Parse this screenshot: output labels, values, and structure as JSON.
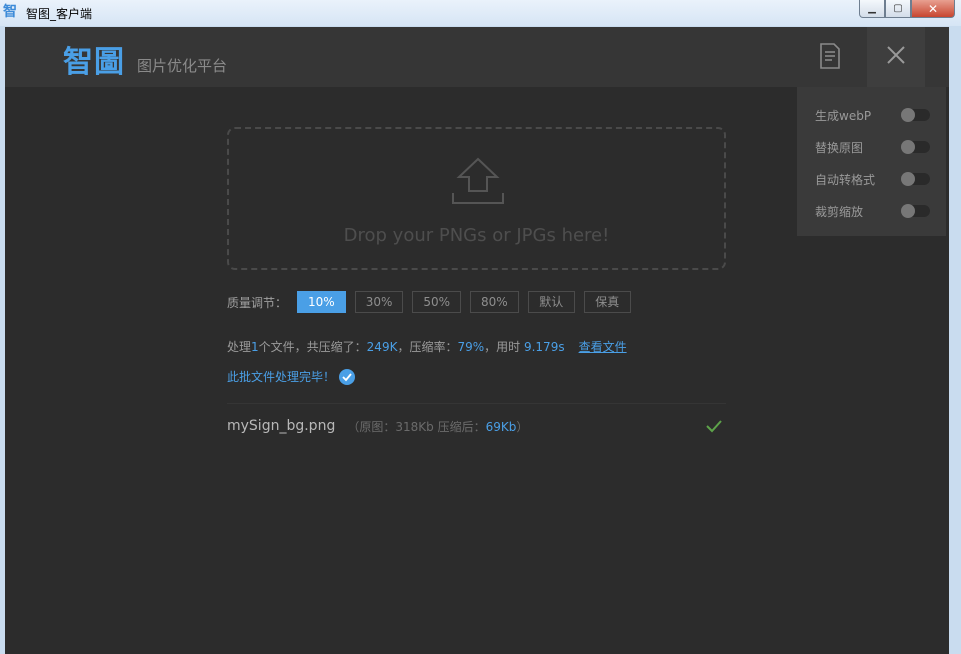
{
  "window": {
    "icon_char": "智",
    "title": "智图_客户端",
    "min_label": "▁",
    "max_label": "▢",
    "close_label": "✕"
  },
  "header": {
    "logo": "智圖",
    "subtitle": "图片优化平台"
  },
  "settings": [
    {
      "label": "生成webP",
      "on": false
    },
    {
      "label": "替换原图",
      "on": false
    },
    {
      "label": "自动转格式",
      "on": false
    },
    {
      "label": "裁剪缩放",
      "on": false
    }
  ],
  "dropzone": {
    "text": "Drop your PNGs or JPGs here!"
  },
  "quality": {
    "label": "质量调节：",
    "options": [
      "10%",
      "30%",
      "50%",
      "80%",
      "默认",
      "保真"
    ],
    "selected": "10%"
  },
  "summary": {
    "prefix": "处理",
    "count": "1",
    "mid1": "个文件，共压缩了：",
    "saved": "249K",
    "mid2": "，压缩率：",
    "rate": "79%",
    "mid3": "，用时 ",
    "time": "9.179s",
    "link": "查看文件"
  },
  "done_text": "此批文件处理完毕！",
  "file": {
    "name": "mySign_bg.png",
    "meta_open": "（原图：",
    "original": "318Kb",
    "meta_mid": "  压缩后：",
    "compressed": "69Kb",
    "meta_close": "）"
  },
  "colors": {
    "accent": "#4a9fe6",
    "success": "#5da34a",
    "background": "#2c2c2c"
  },
  "icons": {
    "doc": "document-icon",
    "close": "close-icon",
    "upload": "upload-icon",
    "check": "check-icon"
  }
}
